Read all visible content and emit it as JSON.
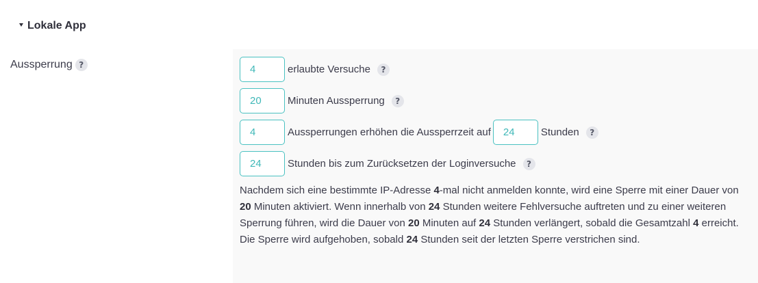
{
  "section": {
    "title": "Lokale App"
  },
  "lockout": {
    "label": "Aussperrung",
    "help_glyph": "?",
    "attempts": {
      "value": "4",
      "label": "erlaubte Versuche"
    },
    "minutes": {
      "value": "20",
      "label": "Minuten Aussperrung"
    },
    "escalation": {
      "count": "4",
      "label": "Aussperrungen erhöhen die Aussperrzeit auf",
      "hours": "24",
      "unit": "Stunden"
    },
    "reset": {
      "value": "24",
      "label": "Stunden bis zum Zurücksetzen der Loginversuche"
    },
    "description": {
      "p1": "Nachdem sich eine bestimmte IP-Adresse ",
      "b1": "4",
      "p2": "-mal nicht anmelden konnte, wird eine Sperre mit einer Dauer von ",
      "b2": "20",
      "p3": " Minuten aktiviert. Wenn innerhalb von ",
      "b3": "24",
      "p4": " Stunden weitere Fehlversuche auftreten und zu einer weiteren Sperrung führen, wird die Dauer von ",
      "b4": "20",
      "p5": " Minuten auf ",
      "b5": "24",
      "p6": " Stunden verlängert, sobald die Gesamtzahl ",
      "b6": "4",
      "p7": " erreicht. Die Sperre wird aufgehoben, sobald ",
      "b7": "24",
      "p8": " Stunden seit der letzten Sperre verstrichen sind."
    }
  },
  "icons": {
    "caret": "caret-down-icon",
    "help": "help-icon"
  },
  "colors": {
    "accent": "#49c1c1",
    "panel_bg": "#f9f9f9",
    "help_bg": "#e4e5ea",
    "text": "#3b3b4a"
  }
}
